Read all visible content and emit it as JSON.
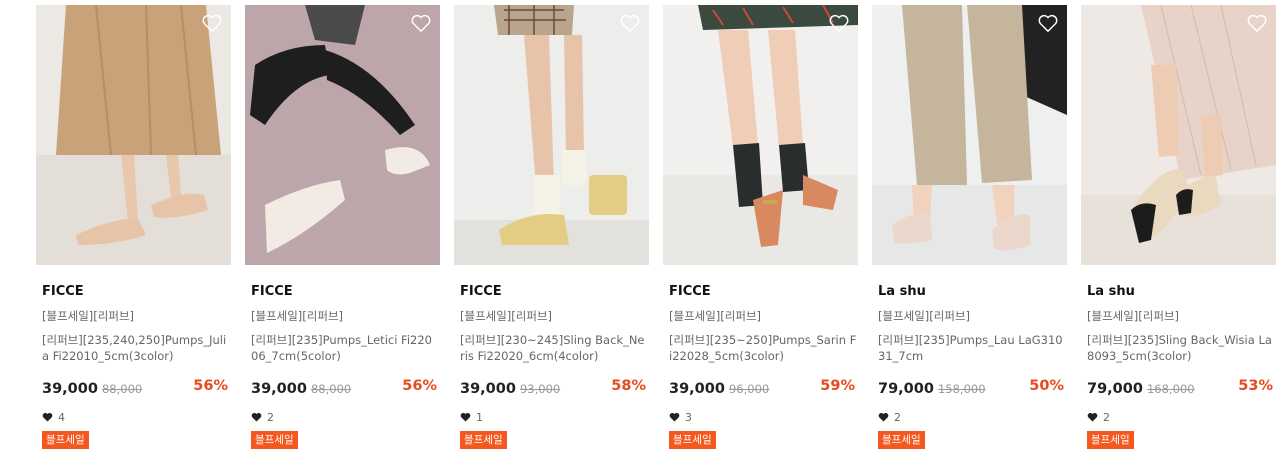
{
  "accent_color": "#f4581f",
  "discount_color": "#e84a1f",
  "products": [
    {
      "brand": "FICCE",
      "tags": "[블프세일][리퍼브]",
      "name": "[리퍼브][235,240,250]Pumps_Julia Fi22010_5cm(3color)",
      "price": "39,000",
      "original_price": "88,000",
      "discount": "56%",
      "likes": "4",
      "badge": "블프세일"
    },
    {
      "brand": "FICCE",
      "tags": "[블프세일][리퍼브]",
      "name": "[리퍼브][235]Pumps_Letici Fi22006_7cm(5color)",
      "price": "39,000",
      "original_price": "88,000",
      "discount": "56%",
      "likes": "2",
      "badge": "블프세일"
    },
    {
      "brand": "FICCE",
      "tags": "[블프세일][리퍼브]",
      "name": "[리퍼브][230~245]Sling Back_Neris Fi22020_6cm(4color)",
      "price": "39,000",
      "original_price": "93,000",
      "discount": "58%",
      "likes": "1",
      "badge": "블프세일"
    },
    {
      "brand": "FICCE",
      "tags": "[블프세일][리퍼브]",
      "name": "[리퍼브][235~250]Pumps_Sarin Fi22028_5cm(3color)",
      "price": "39,000",
      "original_price": "96,000",
      "discount": "59%",
      "likes": "3",
      "badge": "블프세일"
    },
    {
      "brand": "La shu",
      "tags": "[블프세일][리퍼브]",
      "name": "[리퍼브][235]Pumps_Lau LaG31031_7cm",
      "price": "79,000",
      "original_price": "158,000",
      "discount": "50%",
      "likes": "2",
      "badge": "블프세일"
    },
    {
      "brand": "La shu",
      "tags": "[블프세일][리퍼브]",
      "name": "[리퍼브][235]Sling Back_Wisia La8093_5cm(3color)",
      "price": "79,000",
      "original_price": "168,000",
      "discount": "53%",
      "likes": "2",
      "badge": "블프세일"
    }
  ]
}
